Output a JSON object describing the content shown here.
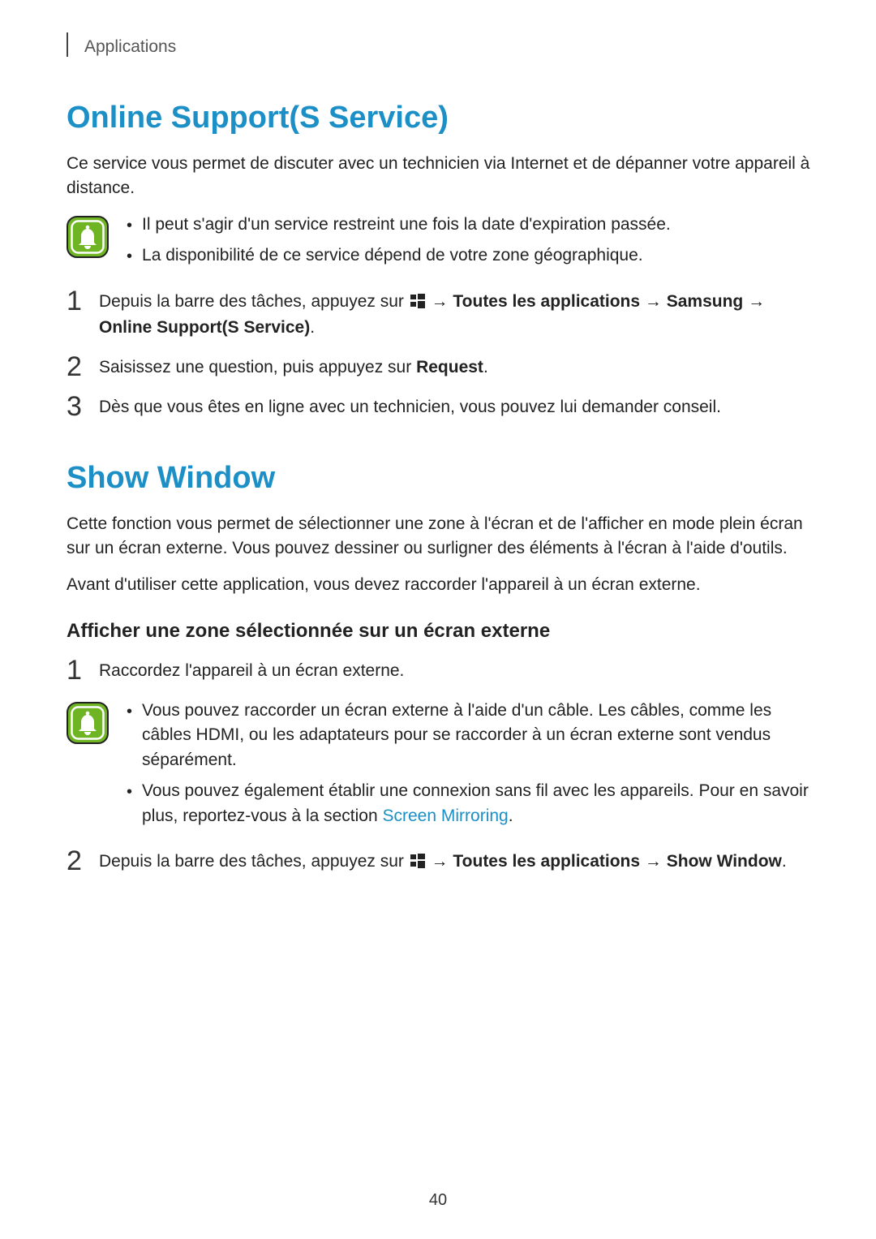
{
  "header": {
    "section": "Applications"
  },
  "section1": {
    "title": "Online Support(S Service)",
    "intro": "Ce service vous permet de discuter avec un technicien via Internet et de dépanner votre appareil à distance.",
    "notes": [
      "Il peut s'agir d'un service restreint une fois la date d'expiration passée.",
      "La disponibilité de ce service dépend de votre zone géographique."
    ],
    "steps": {
      "s1": {
        "prefix": "Depuis la barre des tâches, appuyez sur ",
        "arrow1": " → ",
        "b1": "Toutes les applications",
        "arrow2": " → ",
        "b2": "Samsung",
        "arrow3": " → ",
        "b3": "Online Support(S Service)",
        "period": "."
      },
      "s2": {
        "prefix": "Saisissez une question, puis appuyez sur ",
        "b1": "Request",
        "period": "."
      },
      "s3": "Dès que vous êtes en ligne avec un technicien, vous pouvez lui demander conseil."
    }
  },
  "section2": {
    "title": "Show Window",
    "intro1": "Cette fonction vous permet de sélectionner une zone à l'écran et de l'afficher en mode plein écran sur un écran externe. Vous pouvez dessiner ou surligner des éléments à l'écran à l'aide d'outils.",
    "intro2": "Avant d'utiliser cette application, vous devez raccorder l'appareil à un écran externe.",
    "sub_heading": "Afficher une zone sélectionnée sur un écran externe",
    "steps": {
      "s1": "Raccordez l'appareil à un écran externe."
    },
    "notes": {
      "n1": "Vous pouvez raccorder un écran externe à l'aide d'un câble. Les câbles, comme les câbles HDMI, ou les adaptateurs pour se raccorder à un écran externe sont vendus séparément.",
      "n2_prefix": "Vous pouvez également établir une connexion sans fil avec les appareils. Pour en savoir plus, reportez-vous à la section ",
      "n2_link": "Screen Mirroring",
      "n2_period": "."
    },
    "step2": {
      "prefix": "Depuis la barre des tâches, appuyez sur ",
      "arrow1": " → ",
      "b1": "Toutes les applications",
      "arrow2": " → ",
      "b2": "Show Window",
      "period": "."
    }
  },
  "page": "40"
}
